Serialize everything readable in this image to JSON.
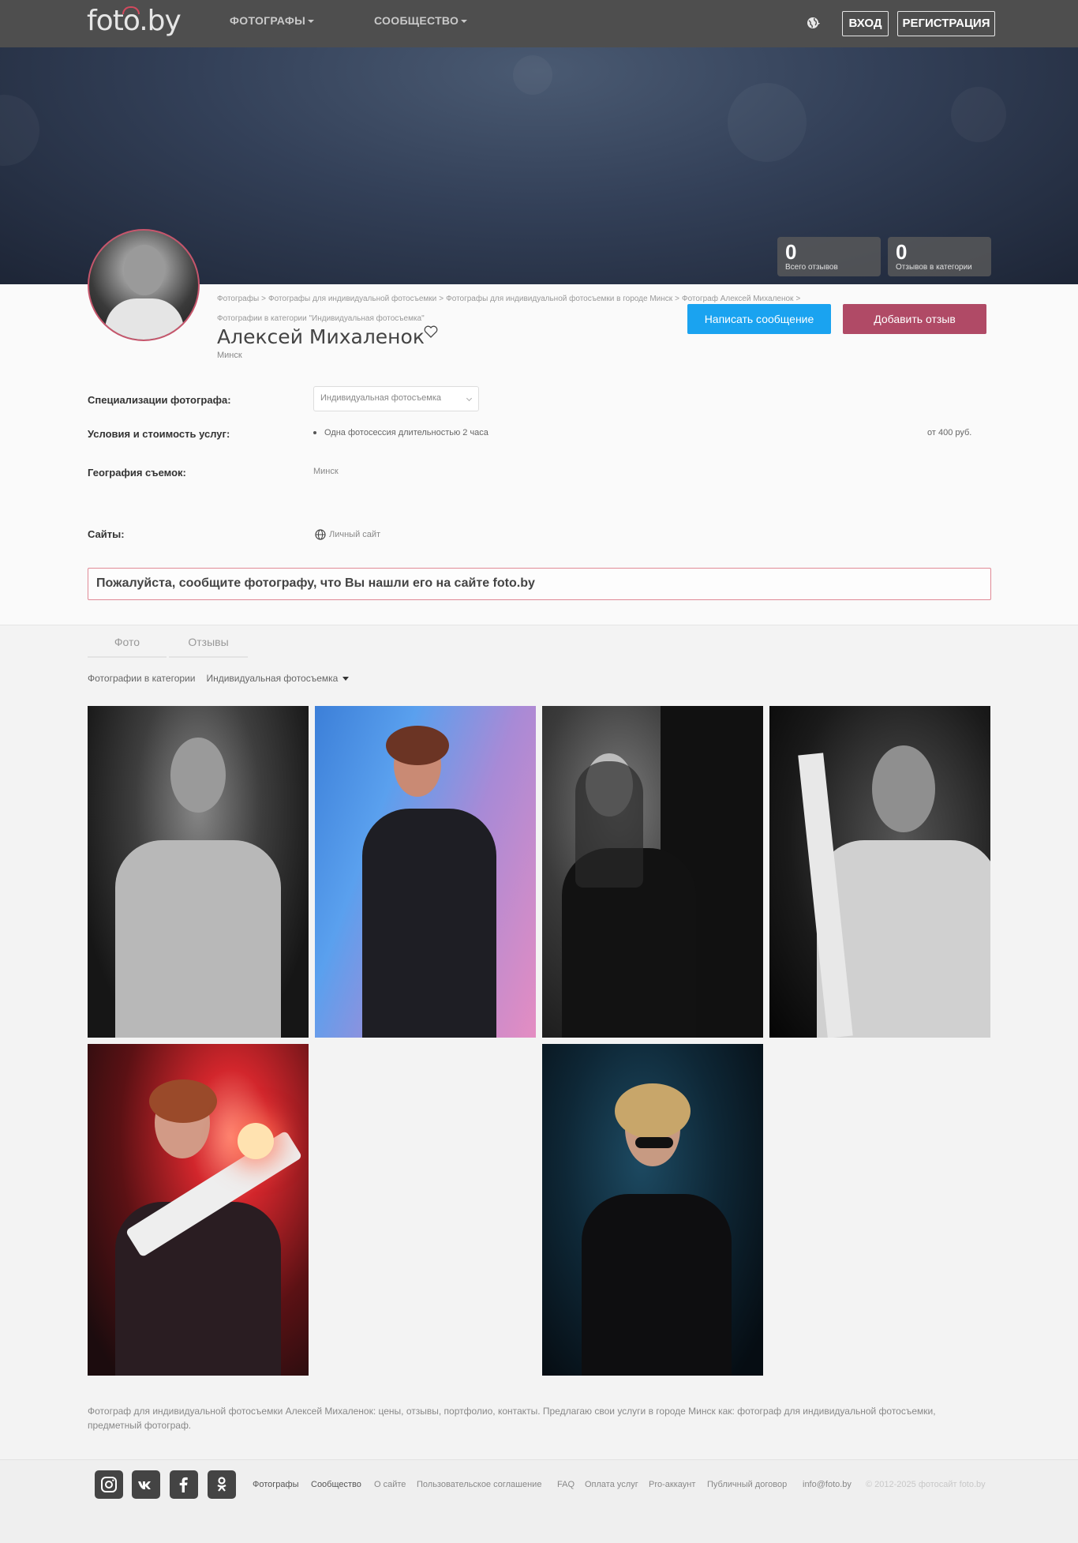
{
  "header": {
    "logo": "foto.by",
    "nav": [
      {
        "label": "ФОТОГРАФЫ"
      },
      {
        "label": "СООБЩЕСТВО"
      }
    ],
    "login_label": "ВХОД",
    "register_label": "РЕГИСТРАЦИЯ"
  },
  "stats": [
    {
      "value": "0",
      "label": "Всего отзывов"
    },
    {
      "value": "0",
      "label": "Отзывов в категории"
    }
  ],
  "breadcrumb": {
    "items": [
      "Фотографы",
      "Фотографы для индивидуальной фотосъемки",
      "Фотографы для индивидуальной фотосъемки в городе Минск",
      "Фотограф Алексей Михаленок"
    ],
    "current": "Фотографии в категории \"Индивидуальная фотосъемка\""
  },
  "profile": {
    "name": "Алексей Михаленок",
    "city": "Минск",
    "message_button": "Написать сообщение",
    "review_button": "Добавить отзыв"
  },
  "details": {
    "spec_label": "Специализации фотографа:",
    "spec_value": "Индивидуальная фотосъемка",
    "terms_label": "Условия и стоимость услуг:",
    "service": "Одна фотосессия длительностью 2 часа",
    "price": "от 400 руб.",
    "geo_label": "География съемок:",
    "geo_value": "Минск",
    "sites_label": "Сайты:",
    "site_value": "Личный сайт"
  },
  "notice": "Пожалуйста, сообщите фотографу, что Вы нашли его на сайте foto.by",
  "tabs": [
    {
      "label": "Фото"
    },
    {
      "label": "Отзывы"
    }
  ],
  "filter": {
    "label": "Фотографии в категории",
    "value": "Индивидуальная фотосъемка"
  },
  "seo_text": "Фотограф для индивидуальной фотосъемки Алексей Михаленок: цены, отзывы, портфолио, контакты. Предлагаю свои услуги в городе Минск как: фотограф для индивидуальной фотосъемки, предметный фотограф.",
  "footer": {
    "social": [
      "instagram-icon",
      "vk-icon",
      "facebook-icon",
      "odnoklassniki-icon"
    ],
    "links": [
      "Фотографы",
      "Сообщество",
      "О сайте",
      "Пользовательское соглашение",
      "FAQ",
      "Оплата услуг",
      "Pro-аккаунт",
      "Публичный договор",
      "info@foto.by"
    ],
    "copyright": "© 2012-2025 фотосайт foto.by"
  },
  "colors": {
    "topbar": "#4e4e4e",
    "message_button": "#1aa3f0",
    "review_button": "#b04a66",
    "notice_border": "#e08a96"
  }
}
